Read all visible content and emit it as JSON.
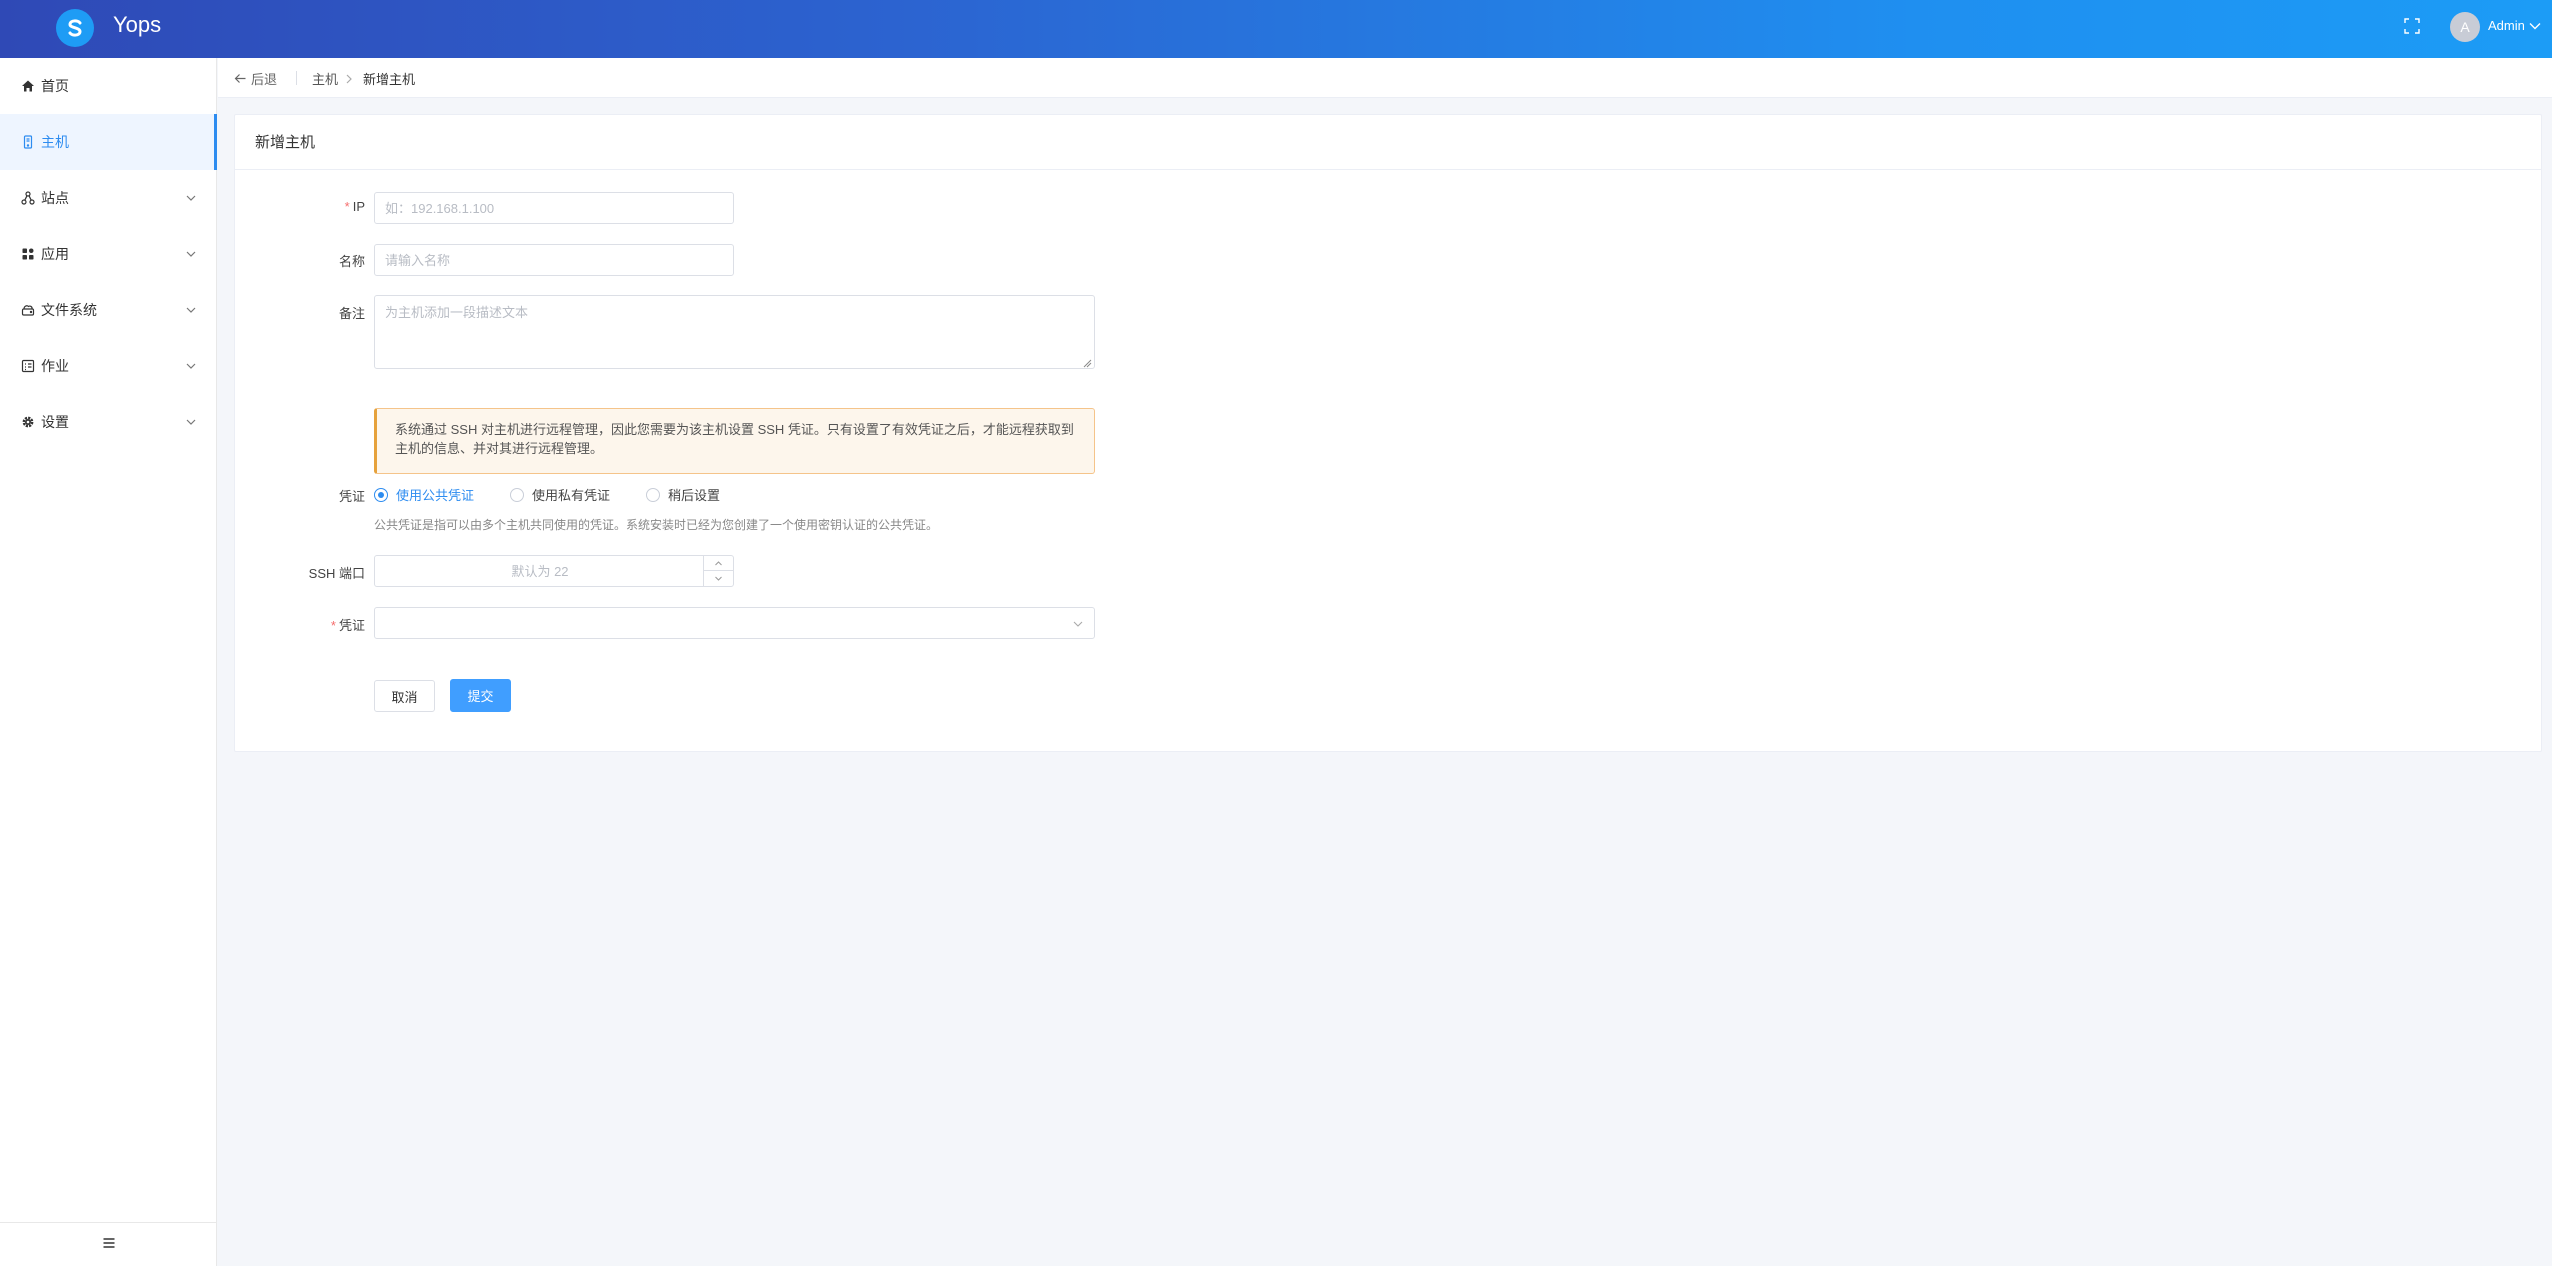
{
  "app": {
    "name": "Yops"
  },
  "header": {
    "user_initial": "A",
    "user_name": "Admin"
  },
  "sidebar": {
    "items": [
      {
        "label": "首页",
        "icon": "home-icon"
      },
      {
        "label": "主机",
        "icon": "server-icon",
        "active": true
      },
      {
        "label": "站点",
        "icon": "sitemap-icon"
      },
      {
        "label": "应用",
        "icon": "apps-icon"
      },
      {
        "label": "文件系统",
        "icon": "cloud-drive-icon"
      },
      {
        "label": "作业",
        "icon": "job-list-icon"
      },
      {
        "label": "设置",
        "icon": "gear-icon"
      }
    ]
  },
  "breadcrumb": {
    "back": "后退",
    "parent": "主机",
    "current": "新增主机"
  },
  "form": {
    "title": "新增主机",
    "ip": {
      "label": "IP",
      "placeholder": "如：192.168.1.100"
    },
    "name": {
      "label": "名称",
      "placeholder": "请输入名称"
    },
    "remark": {
      "label": "备注",
      "placeholder": "为主机添加一段描述文本"
    },
    "alert": "系统通过 SSH 对主机进行远程管理，因此您需要为该主机设置 SSH 凭证。只有设置了有效凭证之后，才能远程获取到主机的信息、并对其进行远程管理。",
    "credential_mode": {
      "label": "凭证",
      "options": [
        "使用公共凭证",
        "使用私有凭证",
        "稍后设置"
      ],
      "selected": "使用公共凭证",
      "help": "公共凭证是指可以由多个主机共同使用的凭证。系统安装时已经为您创建了一个使用密钥认证的公共凭证。"
    },
    "ssh_port": {
      "label": "SSH 端口",
      "placeholder": "默认为 22"
    },
    "credential": {
      "label": "凭证",
      "value": ""
    },
    "cancel": "取消",
    "submit": "提交"
  },
  "colors": {
    "primary": "#409eff",
    "active": "#2d8cf0",
    "required": "#f56c6c",
    "warning": "#e6a23c"
  }
}
